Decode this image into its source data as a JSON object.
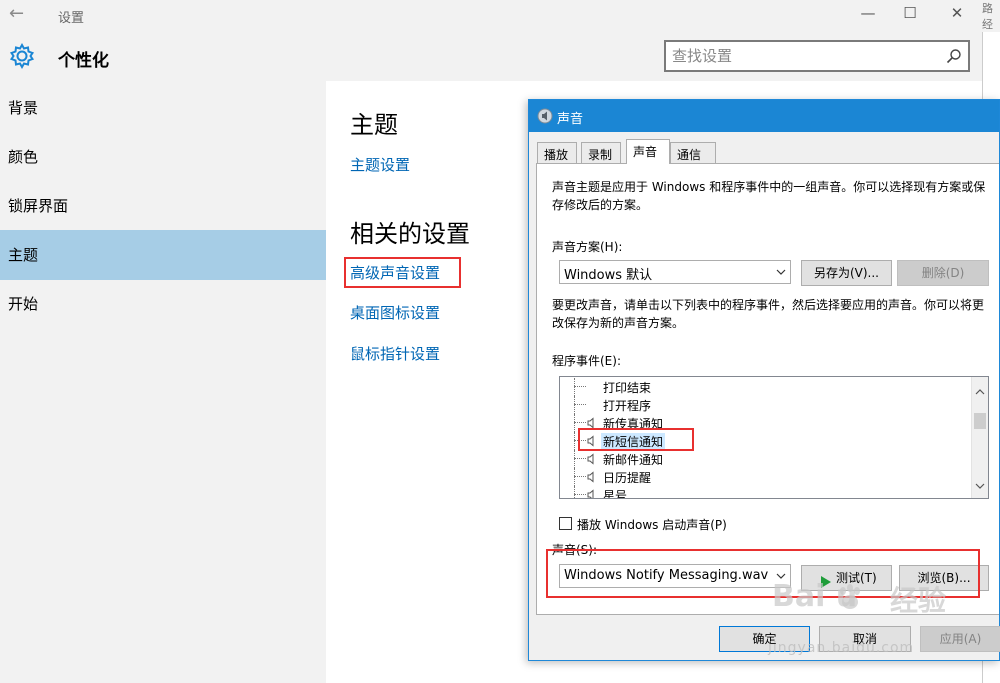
{
  "window": {
    "title": "设置",
    "edge_text": "路经"
  },
  "header": {
    "page_title": "个性化",
    "search_placeholder": "查找设置"
  },
  "sidebar": {
    "items": [
      {
        "label": "背景"
      },
      {
        "label": "颜色"
      },
      {
        "label": "锁屏界面"
      },
      {
        "label": "主题",
        "active": true
      },
      {
        "label": "开始"
      }
    ]
  },
  "content": {
    "theme_heading": "主题",
    "theme_settings_link": "主题设置",
    "related_heading": "相关的设置",
    "advanced_sound_link": "高级声音设置",
    "desktop_icon_link": "桌面图标设置",
    "mouse_pointer_link": "鼠标指针设置"
  },
  "dialog": {
    "title": "声音",
    "tabs": [
      {
        "label": "播放"
      },
      {
        "label": "录制"
      },
      {
        "label": "声音",
        "active": true
      },
      {
        "label": "通信"
      }
    ],
    "description": "声音主题是应用于 Windows 和程序事件中的一组声音。你可以选择现有方案或保存修改后的方案。",
    "scheme_label": "声音方案(H):",
    "scheme_value": "Windows 默认",
    "save_as_label": "另存为(V)...",
    "delete_label": "删除(D)",
    "change_text": "要更改声音，请单击以下列表中的程序事件，然后选择要应用的声音。你可以将更改保存为新的声音方案。",
    "events_label": "程序事件(E):",
    "events": [
      {
        "label": "打印结束",
        "has_sound": false
      },
      {
        "label": "打开程序",
        "has_sound": false
      },
      {
        "label": "新传真通知",
        "has_sound": true
      },
      {
        "label": "新短信通知",
        "has_sound": true,
        "selected": true
      },
      {
        "label": "新邮件通知",
        "has_sound": true
      },
      {
        "label": "日历提醒",
        "has_sound": true
      },
      {
        "label": "星号",
        "has_sound": true
      }
    ],
    "startup_label": "播放 Windows 启动声音(P)",
    "startup_checked": false,
    "sound_label": "声音(S):",
    "sound_value": "Windows Notify Messaging.wav",
    "test_label": "测试(T)",
    "browse_label": "浏览(B)...",
    "ok_label": "确定",
    "cancel_label": "取消",
    "apply_label": "应用(A)"
  },
  "watermark": {
    "brand": "Bai  u",
    "jingyan": "经验",
    "url": "jingyan.baidu.com"
  },
  "colors": {
    "accent": "#1b86d4",
    "link": "#0066b4",
    "sidebar_active": "#a6cde6",
    "highlight_box": "#e8302f",
    "play_icon": "#1f9e3a"
  }
}
